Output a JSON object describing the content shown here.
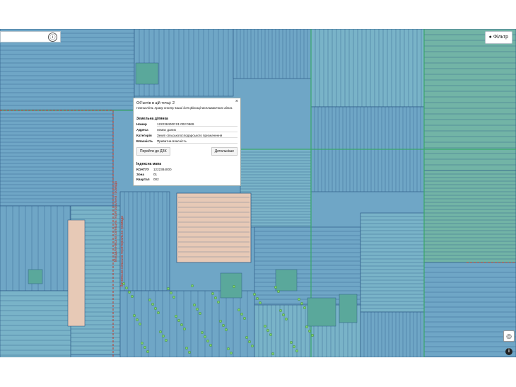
{
  "search": {
    "info_glyph": "ⓘ"
  },
  "filter": {
    "label": "● Фільтр"
  },
  "popup": {
    "title": "Об'єктів в цій точці: 2",
    "hint": "Натисніть праву кнопку миші для фіксації вспливаючого вікна.",
    "close": "×",
    "parcel_section": "Земельна ділянка",
    "parcel_rows": [
      {
        "key": "Номер",
        "value": "1222384000:01:002:0969"
      },
      {
        "key": "Адреса",
        "value": "немає даних"
      },
      {
        "key": "Категорія",
        "value": "Землі сільськогосподарського призначення"
      },
      {
        "key": "Власність",
        "value": "Приватна власність"
      }
    ],
    "btn_dzk": "Перейти до ДЗК",
    "btn_details": "Детальніше",
    "index_section": "Індексна мапа",
    "index_rows": [
      {
        "key": "КОАТУУ",
        "value": "1222384000"
      },
      {
        "key": "Зона",
        "value": "01"
      },
      {
        "key": "Квартал",
        "value": "002"
      }
    ]
  },
  "map": {
    "boundary_label_1": "Магдалинівська селищна територіальна громада",
    "boundary_label_2": "Личківська сільська територіальна громада",
    "colors": {
      "parcel": "#6fa6c6",
      "parcel_alt": "#79b3c8",
      "parcel_green": "#72b4a6",
      "line": "#2f5d88",
      "green_line": "#3aa66a",
      "boundary": "#c0392b",
      "village": "#e7c9b6"
    }
  },
  "controls": {
    "locate_glyph": "◎",
    "info_glyph": "i"
  }
}
